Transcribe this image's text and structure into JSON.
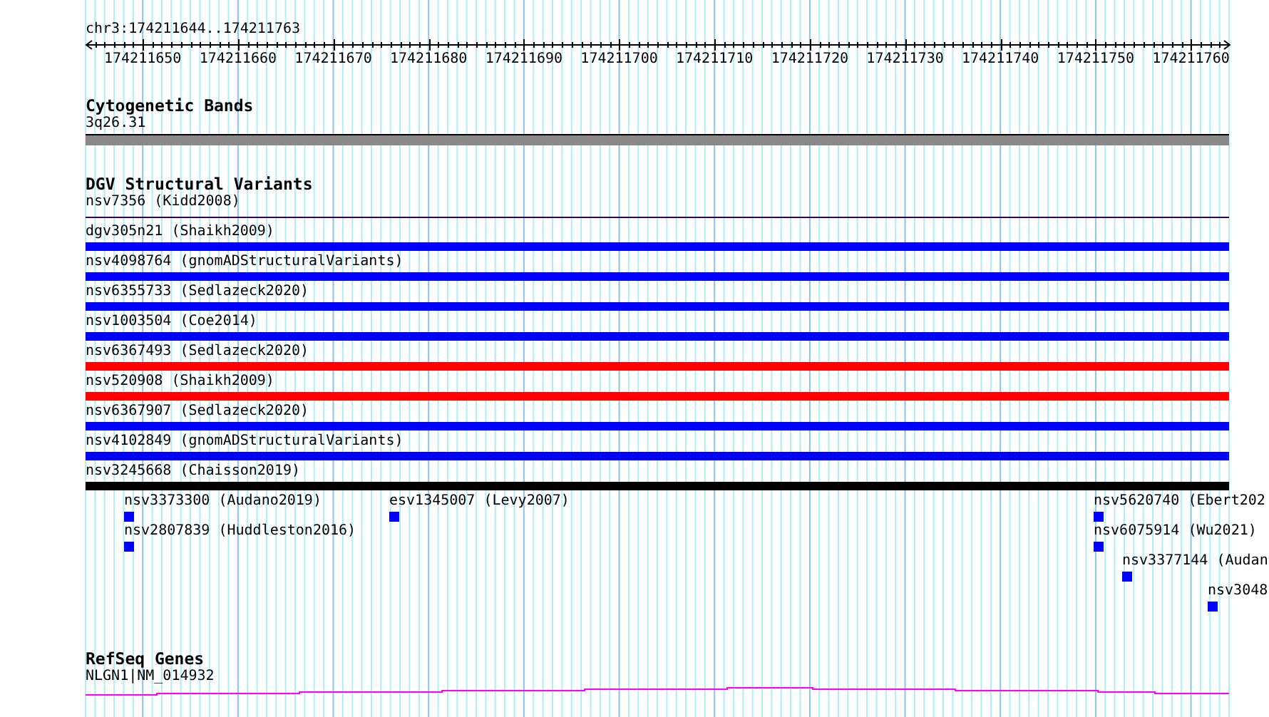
{
  "ruler": {
    "locus": "chr3:174211644..174211763",
    "labels": [
      "174211650",
      "174211660",
      "174211670",
      "174211680",
      "174211690",
      "174211700",
      "174211710",
      "174211720",
      "174211730",
      "174211740",
      "174211750",
      "174211760"
    ]
  },
  "cytogenetic_bands": {
    "title": "Cytogenetic Bands",
    "band": "3q26.31"
  },
  "dgv_structural_variants": {
    "title": "DGV Structural Variants",
    "features": [
      {
        "label": "nsv7356 (Kidd2008)",
        "kind": "line",
        "color": "#330066"
      },
      {
        "label": "dgv305n21 (Shaikh2009)",
        "kind": "bar",
        "color": "#0000ff"
      },
      {
        "label": "nsv4098764 (gnomADStructuralVariants)",
        "kind": "bar",
        "color": "#0000ff"
      },
      {
        "label": "nsv6355733 (Sedlazeck2020)",
        "kind": "bar",
        "color": "#0000ff"
      },
      {
        "label": "nsv1003504 (Coe2014)",
        "kind": "bar",
        "color": "#0000ff"
      },
      {
        "label": "nsv6367493 (Sedlazeck2020)",
        "kind": "bar",
        "color": "#ff0000"
      },
      {
        "label": "nsv520908 (Shaikh2009)",
        "kind": "bar",
        "color": "#ff0000"
      },
      {
        "label": "nsv6367907 (Sedlazeck2020)",
        "kind": "bar",
        "color": "#0000ff"
      },
      {
        "label": "nsv4102849 (gnomADStructuralVariants)",
        "kind": "bar",
        "color": "#0000ff"
      },
      {
        "label": "nsv3245668 (Chaisson2019)",
        "kind": "bar",
        "color": "#000000"
      }
    ],
    "small_features": [
      {
        "label": "nsv3373300 (Audano2019)"
      },
      {
        "label": "nsv2807839 (Huddleston2016)"
      },
      {
        "label": "esv1345007 (Levy2007)"
      },
      {
        "label": "nsv5620740 (Ebert202"
      },
      {
        "label": "nsv6075914 (Wu2021)"
      },
      {
        "label": "nsv3377144 (Audan"
      },
      {
        "label": "nsv3048"
      }
    ]
  },
  "refseq_genes": {
    "title": "RefSeq Genes",
    "gene": "NLGN1|NM_014932"
  }
}
